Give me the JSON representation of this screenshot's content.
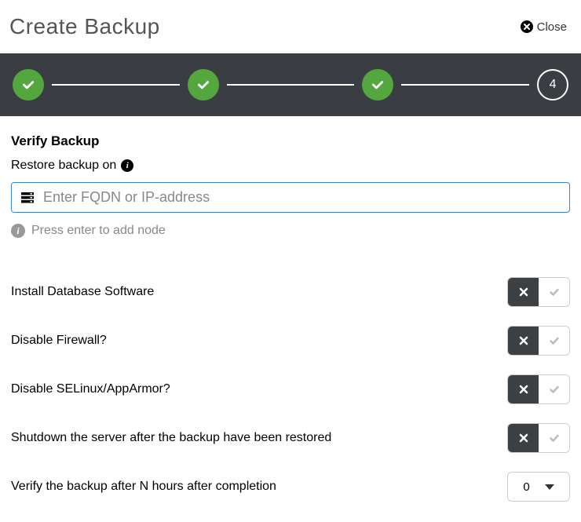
{
  "header": {
    "title": "Create Backup",
    "close_label": "Close"
  },
  "stepper": {
    "current_step_number": "4"
  },
  "main": {
    "section_title": "Verify Backup",
    "restore_label": "Restore backup on",
    "fqdn_placeholder": "Enter FQDN or IP-address",
    "fqdn_value": "",
    "helper_text": "Press enter to add node"
  },
  "options": [
    {
      "label": "Install Database Software",
      "value": "off"
    },
    {
      "label": "Disable Firewall?",
      "value": "off"
    },
    {
      "label": "Disable SELinux/AppArmor?",
      "value": "off"
    },
    {
      "label": "Shutdown the server after the backup have been restored",
      "value": "off"
    }
  ],
  "verify_after": {
    "label": "Verify the backup after N hours after completion",
    "value": "0"
  }
}
